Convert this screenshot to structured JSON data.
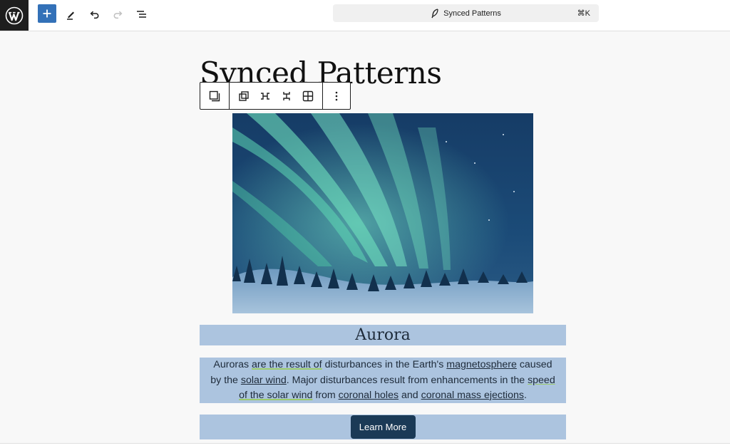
{
  "header": {
    "command_label": "Synced Patterns",
    "command_shortcut": "⌘K",
    "icons": [
      "wordpress-logo-icon",
      "plus-icon",
      "pencil-icon",
      "undo-icon",
      "redo-icon",
      "list-view-icon",
      "feather-icon"
    ]
  },
  "block_toolbar": {
    "icons": [
      "pattern-icon",
      "duplicate-icon",
      "expand-horizontal-icon",
      "expand-vertical-icon",
      "grid-icon",
      "more-options-icon"
    ]
  },
  "content": {
    "page_title": "Synced Patterns",
    "heading": "Aurora",
    "paragraph_lines": [
      [
        "Auroras ",
        "are the result of",
        " disturbances in the Earth's ",
        "magnetosphere",
        " caused"
      ],
      [
        "by the ",
        "solar wind",
        ". Major disturbances result from enhancements in the ",
        "speed"
      ],
      [
        "of the solar wind",
        " from ",
        "coronal holes",
        " and ",
        "coronal mass ejections",
        "."
      ]
    ],
    "button_label": "Learn More"
  },
  "colors": {
    "accent": "#3371b8",
    "block_highlight": "#acc4df",
    "button_bg": "#1b3a56"
  }
}
